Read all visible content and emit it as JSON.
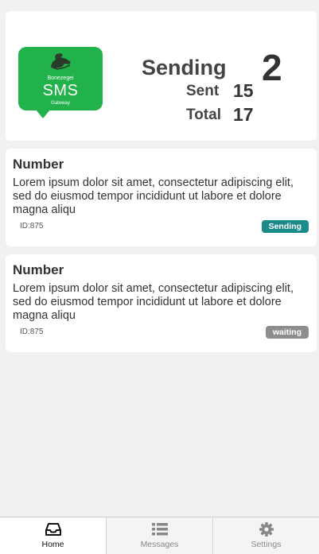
{
  "header": {
    "logo": {
      "brand": "Bonezegei",
      "title": "SMS",
      "subtitle": "Gateway"
    },
    "sending_label": "Sending",
    "sending_count": "2",
    "sent_label": "Sent",
    "sent_value": "15",
    "total_label": "Total",
    "total_value": "17"
  },
  "messages": [
    {
      "title": "Number",
      "body": "Lorem ipsum dolor sit amet, consectetur adipiscing elit, sed do eiusmod tempor incididunt ut labore et dolore magna aliqu",
      "id": "ID:875",
      "status": "Sending"
    },
    {
      "title": "Number",
      "body": "Lorem ipsum dolor sit amet, consectetur adipiscing elit, sed do eiusmod tempor incididunt ut labore et dolore magna aliqu",
      "id": "ID:875",
      "status": "waiting"
    }
  ],
  "tabs": [
    {
      "label": "Home",
      "icon": "inbox-icon",
      "active": true
    },
    {
      "label": "Messages",
      "icon": "list-icon",
      "active": false
    },
    {
      "label": "Settings",
      "icon": "gear-icon",
      "active": false
    }
  ],
  "colors": {
    "logo_green": "#22b24c",
    "badge_sending": "#1a8a8a",
    "badge_waiting": "#8d8d8d",
    "background": "#f1f1f1"
  }
}
